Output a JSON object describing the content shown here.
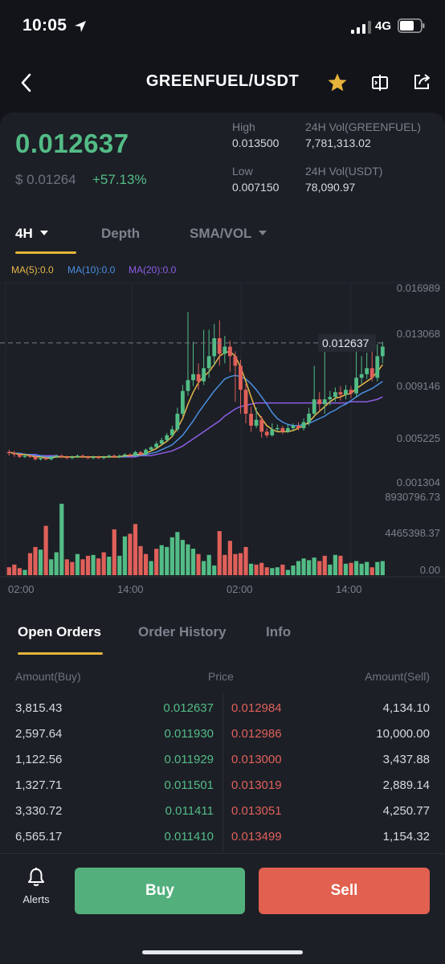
{
  "status_bar": {
    "time": "10:05",
    "network": "4G"
  },
  "nav": {
    "title": "GREENFUEL/USDT",
    "favorited": true
  },
  "ticker": {
    "last_price": "0.012637",
    "usd_price": "$ 0.01264",
    "change": "+57.13%",
    "high_label": "High",
    "high_value": "0.013500",
    "low_label": "Low",
    "low_value": "0.007150",
    "vol_base_label": "24H Vol(GREENFUEL)",
    "vol_base_value": "7,781,313.02",
    "vol_quote_label": "24H Vol(USDT)",
    "vol_quote_value": "78,090.97"
  },
  "chart_tabs": {
    "interval": "4H",
    "depth": "Depth",
    "indicator": "SMA/VOL"
  },
  "ma_legend": {
    "ma5": "MA(5):0.0",
    "ma10": "MA(10):0.0",
    "ma20": "MA(20):0.0"
  },
  "colors": {
    "up": "#53bc86",
    "down": "#e0605a",
    "accent": "#e6b43a",
    "ma5": "#e8b84a",
    "ma10": "#4a8fe0",
    "ma20": "#8d5ee6"
  },
  "chart_data": {
    "type": "candlestick",
    "price_axis_labels": [
      "0.016989",
      "0.013068",
      "0.009146",
      "0.005225",
      "0.001304"
    ],
    "price_ylim": [
      0.001304,
      0.016989
    ],
    "last_price_label": "0.012637",
    "volume_axis_labels": [
      "8930796.73",
      "4465398.37",
      "0.00"
    ],
    "volume_ylim": [
      0,
      8930796.73
    ],
    "time_labels": [
      "02:00",
      "14:00",
      "02:00",
      "14:00"
    ],
    "candles": [
      [
        0.0038,
        0.0037,
        0.004,
        0.0035,
        0.9,
        -1
      ],
      [
        0.0037,
        0.0036,
        0.0039,
        0.0034,
        1.2,
        -1
      ],
      [
        0.0036,
        0.0034,
        0.0037,
        0.0033,
        0.8,
        -1
      ],
      [
        0.0034,
        0.0035,
        0.0037,
        0.0033,
        0.6,
        1
      ],
      [
        0.0035,
        0.0034,
        0.0036,
        0.0033,
        2.5,
        -1
      ],
      [
        0.0034,
        0.0032,
        0.0035,
        0.0031,
        3.2,
        -1
      ],
      [
        0.0032,
        0.0033,
        0.0035,
        0.0031,
        2.9,
        1
      ],
      [
        0.0033,
        0.0032,
        0.0034,
        0.0031,
        5.6,
        -1
      ],
      [
        0.0032,
        0.0034,
        0.0035,
        0.0031,
        1.8,
        1
      ],
      [
        0.0034,
        0.0035,
        0.0036,
        0.0033,
        2.6,
        1
      ],
      [
        0.0035,
        0.0034,
        0.0036,
        0.0033,
        8.1,
        1
      ],
      [
        0.0034,
        0.0033,
        0.0035,
        0.0032,
        1.8,
        -1
      ],
      [
        0.0033,
        0.0034,
        0.0035,
        0.0032,
        1.5,
        -1
      ],
      [
        0.0034,
        0.0035,
        0.0036,
        0.0033,
        2.4,
        1
      ],
      [
        0.0035,
        0.0034,
        0.0036,
        0.0033,
        1.8,
        -1
      ],
      [
        0.0034,
        0.0033,
        0.0035,
        0.0032,
        2.2,
        -1
      ],
      [
        0.0033,
        0.0034,
        0.0035,
        0.0032,
        2.3,
        1
      ],
      [
        0.0034,
        0.0033,
        0.0035,
        0.0032,
        1.9,
        -1
      ],
      [
        0.0033,
        0.0034,
        0.0035,
        0.0032,
        2.6,
        -1
      ],
      [
        0.0034,
        0.0035,
        0.0036,
        0.0033,
        2.1,
        1
      ],
      [
        0.0035,
        0.0034,
        0.0036,
        0.0033,
        5.2,
        -1
      ],
      [
        0.0034,
        0.0035,
        0.0036,
        0.0033,
        2.2,
        1
      ],
      [
        0.0035,
        0.0036,
        0.0037,
        0.0034,
        4.4,
        1
      ],
      [
        0.0036,
        0.0035,
        0.0037,
        0.0034,
        4.7,
        -1
      ],
      [
        0.0035,
        0.0038,
        0.0039,
        0.0034,
        5.8,
        -1
      ],
      [
        0.0038,
        0.0036,
        0.0039,
        0.0035,
        3.3,
        -1
      ],
      [
        0.0036,
        0.004,
        0.0041,
        0.0035,
        2.4,
        -1
      ],
      [
        0.004,
        0.0042,
        0.0043,
        0.0039,
        1.6,
        1
      ],
      [
        0.0042,
        0.0045,
        0.0047,
        0.0041,
        3.0,
        -1
      ],
      [
        0.0045,
        0.0048,
        0.005,
        0.0044,
        3.4,
        1
      ],
      [
        0.0048,
        0.0052,
        0.0054,
        0.0047,
        3.2,
        1
      ],
      [
        0.0052,
        0.0057,
        0.006,
        0.0051,
        4.3,
        1
      ],
      [
        0.0057,
        0.007,
        0.0075,
        0.0055,
        4.9,
        1
      ],
      [
        0.007,
        0.0089,
        0.0094,
        0.0068,
        4.0,
        1
      ],
      [
        0.0089,
        0.0098,
        0.0155,
        0.0085,
        3.5,
        1
      ],
      [
        0.0098,
        0.0103,
        0.013,
        0.0093,
        3.0,
        1
      ],
      [
        0.0103,
        0.0097,
        0.0112,
        0.009,
        2.4,
        -1
      ],
      [
        0.0097,
        0.0108,
        0.014,
        0.0094,
        1.6,
        1
      ],
      [
        0.0108,
        0.0118,
        0.014,
        0.01,
        2.3,
        1
      ],
      [
        0.0118,
        0.0133,
        0.0145,
        0.011,
        1.1,
        1
      ],
      [
        0.0133,
        0.012,
        0.0148,
        0.011,
        5.0,
        -1
      ],
      [
        0.012,
        0.0126,
        0.0135,
        0.0112,
        2.3,
        -1
      ],
      [
        0.0126,
        0.0118,
        0.0131,
        0.0105,
        3.9,
        -1
      ],
      [
        0.0118,
        0.011,
        0.0122,
        0.008,
        2.4,
        -1
      ],
      [
        0.011,
        0.009,
        0.0115,
        0.007,
        2.5,
        -1
      ],
      [
        0.009,
        0.007,
        0.0095,
        0.0062,
        3.2,
        -1
      ],
      [
        0.007,
        0.006,
        0.0076,
        0.0055,
        1.3,
        1
      ],
      [
        0.006,
        0.0065,
        0.0075,
        0.0058,
        1.2,
        -1
      ],
      [
        0.0065,
        0.0055,
        0.0068,
        0.005,
        1.4,
        -1
      ],
      [
        0.0055,
        0.0052,
        0.0058,
        0.005,
        0.9,
        -1
      ],
      [
        0.0052,
        0.0057,
        0.0062,
        0.0051,
        0.8,
        1
      ],
      [
        0.0057,
        0.0058,
        0.0061,
        0.0055,
        0.9,
        1
      ],
      [
        0.0058,
        0.0055,
        0.006,
        0.0053,
        1.2,
        -1
      ],
      [
        0.0055,
        0.0058,
        0.0061,
        0.0054,
        0.6,
        1
      ],
      [
        0.0058,
        0.006,
        0.0062,
        0.0056,
        1.1,
        1
      ],
      [
        0.006,
        0.0058,
        0.0063,
        0.0056,
        1.6,
        1
      ],
      [
        0.0058,
        0.0063,
        0.0066,
        0.0056,
        1.9,
        1
      ],
      [
        0.0063,
        0.007,
        0.0075,
        0.006,
        1.7,
        1
      ],
      [
        0.007,
        0.0082,
        0.011,
        0.0068,
        2.0,
        1
      ],
      [
        0.0082,
        0.0078,
        0.0088,
        0.0072,
        1.6,
        -1
      ],
      [
        0.0078,
        0.0082,
        0.0135,
        0.007,
        2.2,
        -1
      ],
      [
        0.0082,
        0.0084,
        0.0089,
        0.0077,
        1.2,
        1
      ],
      [
        0.0084,
        0.0088,
        0.0092,
        0.008,
        2.3,
        1
      ],
      [
        0.0088,
        0.0086,
        0.0093,
        0.0081,
        2.2,
        -1
      ],
      [
        0.0086,
        0.009,
        0.0094,
        0.0082,
        1.3,
        1
      ],
      [
        0.009,
        0.0087,
        0.0093,
        0.0083,
        1.4,
        -1
      ],
      [
        0.0087,
        0.01,
        0.0125,
        0.0084,
        1.6,
        1
      ],
      [
        0.01,
        0.0103,
        0.0118,
        0.0095,
        1.3,
        1
      ],
      [
        0.0103,
        0.0108,
        0.0121,
        0.0099,
        1.5,
        1
      ],
      [
        0.0108,
        0.01,
        0.0124,
        0.0097,
        0.9,
        -1
      ],
      [
        0.01,
        0.0118,
        0.0128,
        0.0097,
        1.5,
        1
      ],
      [
        0.0118,
        0.0126,
        0.013,
        0.0112,
        1.6,
        1
      ]
    ],
    "ma5": [
      0.0038,
      0.0037,
      0.0036,
      0.0036,
      0.0035,
      0.0034,
      0.0034,
      0.0033,
      0.0033,
      0.0034,
      0.0034,
      0.0034,
      0.0034,
      0.0034,
      0.0034,
      0.0034,
      0.0034,
      0.0034,
      0.0034,
      0.0034,
      0.0034,
      0.0034,
      0.0035,
      0.0035,
      0.0036,
      0.0036,
      0.0037,
      0.0039,
      0.0041,
      0.0044,
      0.0047,
      0.0051,
      0.0058,
      0.0066,
      0.0078,
      0.0088,
      0.0096,
      0.0101,
      0.0105,
      0.0111,
      0.0118,
      0.0121,
      0.0122,
      0.0118,
      0.0109,
      0.0097,
      0.0084,
      0.0072,
      0.0066,
      0.006,
      0.0057,
      0.0055,
      0.0055,
      0.0055,
      0.0056,
      0.0058,
      0.006,
      0.0063,
      0.0068,
      0.0072,
      0.0076,
      0.008,
      0.0083,
      0.0084,
      0.0086,
      0.0087,
      0.0091,
      0.0094,
      0.0097,
      0.01,
      0.0105,
      0.0111
    ],
    "ma10": [
      0.0038,
      0.0037,
      0.0037,
      0.0036,
      0.0036,
      0.0035,
      0.0035,
      0.0034,
      0.0034,
      0.0034,
      0.0034,
      0.0034,
      0.0034,
      0.0034,
      0.0034,
      0.0034,
      0.0034,
      0.0034,
      0.0034,
      0.0034,
      0.0034,
      0.0034,
      0.0034,
      0.0035,
      0.0035,
      0.0035,
      0.0036,
      0.0037,
      0.0038,
      0.004,
      0.0042,
      0.0044,
      0.0048,
      0.0052,
      0.0058,
      0.0064,
      0.0071,
      0.0077,
      0.0083,
      0.0089,
      0.0094,
      0.0099,
      0.0101,
      0.0102,
      0.0101,
      0.0099,
      0.0095,
      0.009,
      0.0084,
      0.0078,
      0.0071,
      0.0066,
      0.0063,
      0.0061,
      0.006,
      0.006,
      0.0061,
      0.0062,
      0.0064,
      0.0066,
      0.0068,
      0.0071,
      0.0073,
      0.0076,
      0.0078,
      0.0081,
      0.0084,
      0.0087,
      0.0089,
      0.0091,
      0.0094,
      0.0097
    ],
    "ma20": [
      0.0038,
      0.0037,
      0.0037,
      0.0036,
      0.0036,
      0.0036,
      0.0035,
      0.0035,
      0.0035,
      0.0035,
      0.0034,
      0.0034,
      0.0034,
      0.0034,
      0.0034,
      0.0034,
      0.0034,
      0.0034,
      0.0034,
      0.0034,
      0.0034,
      0.0034,
      0.0034,
      0.0034,
      0.0034,
      0.0035,
      0.0035,
      0.0035,
      0.0036,
      0.0037,
      0.0038,
      0.0039,
      0.0041,
      0.0043,
      0.0046,
      0.0049,
      0.0052,
      0.0055,
      0.0058,
      0.0061,
      0.0064,
      0.0068,
      0.0071,
      0.0074,
      0.0076,
      0.0077,
      0.0078,
      0.0079,
      0.0079,
      0.0079,
      0.0079,
      0.0079,
      0.0079,
      0.0079,
      0.0079,
      0.0079,
      0.0079,
      0.0079,
      0.0079,
      0.0079,
      0.0079,
      0.0079,
      0.0079,
      0.0079,
      0.0079,
      0.008,
      0.008,
      0.008,
      0.008,
      0.0081,
      0.0082,
      0.0084
    ]
  },
  "bottom_tabs": {
    "open_orders": "Open Orders",
    "order_history": "Order History",
    "info": "Info"
  },
  "order_book": {
    "header_buy": "Amount(Buy)",
    "header_price": "Price",
    "header_sell": "Amount(Sell)",
    "rows": [
      {
        "buy_amount": "3,815.43",
        "buy_price": "0.012637",
        "sell_price": "0.012984",
        "sell_amount": "4,134.10"
      },
      {
        "buy_amount": "2,597.64",
        "buy_price": "0.011930",
        "sell_price": "0.012986",
        "sell_amount": "10,000.00"
      },
      {
        "buy_amount": "1,122.56",
        "buy_price": "0.011929",
        "sell_price": "0.013000",
        "sell_amount": "3,437.88"
      },
      {
        "buy_amount": "1,327.71",
        "buy_price": "0.011501",
        "sell_price": "0.013019",
        "sell_amount": "2,889.14"
      },
      {
        "buy_amount": "3,330.72",
        "buy_price": "0.011411",
        "sell_price": "0.013051",
        "sell_amount": "4,250.77"
      },
      {
        "buy_amount": "6,565.17",
        "buy_price": "0.011410",
        "sell_price": "0.013499",
        "sell_amount": "1,154.32"
      }
    ]
  },
  "bottom_bar": {
    "alerts_label": "Alerts",
    "buy_label": "Buy",
    "sell_label": "Sell"
  }
}
